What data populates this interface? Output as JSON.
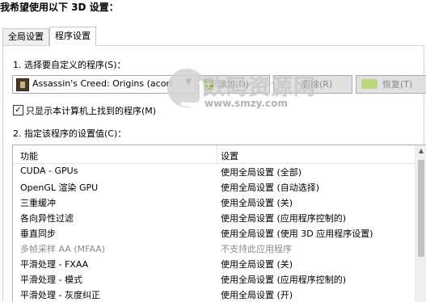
{
  "heading": "我希望使用以下 3D 设置：",
  "tabs": [
    {
      "label": "全局设置",
      "active": false
    },
    {
      "label": "程序设置",
      "active": true
    }
  ],
  "section1_label": "1. 选择要自定义的程序(S)：",
  "program_select": {
    "value": "Assassin's Creed: Origins (acori"
  },
  "buttons": {
    "add": "添加(D)",
    "delete": "删除(R)",
    "restore": "恢复(T)"
  },
  "show_only_checkbox": {
    "label": "只显示本计算机上找到的程序(M)",
    "checked": true
  },
  "section2_label": "2. 指定该程序的设置值(C)：",
  "table": {
    "headers": [
      "功能",
      "设置"
    ],
    "rows": [
      {
        "feature": "CUDA - GPUs",
        "setting": "使用全局设置 (全部)",
        "disabled": false
      },
      {
        "feature": "OpenGL 渲染 GPU",
        "setting": "使用全局设置 (自动选择)",
        "disabled": false
      },
      {
        "feature": "三重缓冲",
        "setting": "使用全局设置 (关)",
        "disabled": false
      },
      {
        "feature": "各向异性过滤",
        "setting": "使用全局设置 (应用程序控制的)",
        "disabled": false
      },
      {
        "feature": "垂直同步",
        "setting": "使用全局设置 (使用 3D 应用程序设置)",
        "disabled": false
      },
      {
        "feature": "多帧采样 AA (MFAA)",
        "setting": "不支持此应用程序",
        "disabled": true
      },
      {
        "feature": "平滑处理 - FXAA",
        "setting": "使用全局设置 (关)",
        "disabled": false
      },
      {
        "feature": "平滑处理 - 模式",
        "setting": "使用全局设置 (应用程序控制的)",
        "disabled": false
      },
      {
        "feature": "平滑处理 - 灰度纠正",
        "setting": "使用全局设置 (开)",
        "disabled": false
      }
    ]
  },
  "watermark": {
    "name": "数码资源网",
    "url": "www.smzy.com"
  },
  "colors": {
    "nvidia_green": "#76b900",
    "disabled_text": "#8c8c8c"
  }
}
